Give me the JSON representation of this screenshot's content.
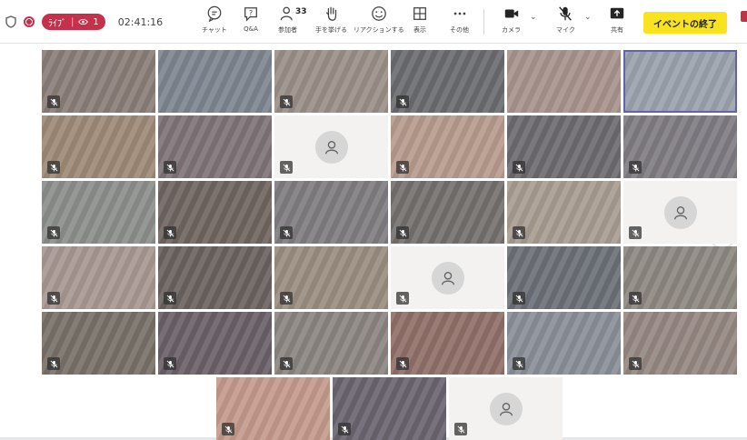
{
  "toolbar": {
    "live_label": "ﾗｲﾌﾞ",
    "viewer_count": "1",
    "elapsed_time": "02:41:16",
    "buttons": [
      {
        "label": "チャット",
        "icon": "chat-icon"
      },
      {
        "label": "Q&A",
        "icon": "qa-icon"
      },
      {
        "label": "参加者",
        "icon": "participants-icon",
        "count": "33"
      },
      {
        "label": "手を挙げる",
        "icon": "raise-hand-icon"
      },
      {
        "label": "リアクションする",
        "icon": "reaction-icon"
      },
      {
        "label": "表示",
        "icon": "view-icon"
      },
      {
        "label": "その他",
        "icon": "more-icon"
      },
      {
        "label": "カメラ",
        "icon": "camera-icon"
      },
      {
        "label": "マイク",
        "icon": "mic-off-icon"
      },
      {
        "label": "共有",
        "icon": "share-icon"
      }
    ],
    "end_event_label": "イベントの終了",
    "accent_color": "#f8e31e",
    "live_color": "#c4314b"
  },
  "grid": {
    "empty_tile_icon": "participant-avatar-icon",
    "muted_icon": "mic-muted-icon",
    "next_page_icon": "chevron-right-icon",
    "tiles": [
      {
        "tone": "#8a7d78",
        "muted": true
      },
      {
        "tone": "#7d8590",
        "muted": false
      },
      {
        "tone": "#9a8f88",
        "muted": true
      },
      {
        "tone": "#6b6c70",
        "muted": true
      },
      {
        "tone": "#a8928c",
        "muted": false
      },
      {
        "tone": "#9ba2ad",
        "muted": false,
        "active": true
      },
      {
        "tone": "#9d8a76",
        "muted": true
      },
      {
        "tone": "#7e7478",
        "muted": true
      },
      {
        "empty": true,
        "muted": true
      },
      {
        "tone": "#b89a8d",
        "muted": true
      },
      {
        "tone": "#6d6a70",
        "muted": true
      },
      {
        "tone": "#7f7b82",
        "muted": true
      },
      {
        "tone": "#8c8e8b",
        "muted": true
      },
      {
        "tone": "#6f6460",
        "muted": true
      },
      {
        "tone": "#807c80",
        "muted": true
      },
      {
        "tone": "#74706e",
        "muted": true
      },
      {
        "tone": "#a79c90",
        "muted": true
      },
      {
        "empty": true,
        "muted": true
      },
      {
        "tone": "#a89792",
        "muted": true
      },
      {
        "tone": "#6a625e",
        "muted": true
      },
      {
        "tone": "#9a8c80",
        "muted": true
      },
      {
        "empty": true,
        "muted": true
      },
      {
        "tone": "#6b6f77",
        "muted": true
      },
      {
        "tone": "#8c8881",
        "muted": true
      },
      {
        "tone": "#787068",
        "muted": true
      },
      {
        "tone": "#6a6068",
        "muted": true
      },
      {
        "tone": "#8b8580",
        "muted": true
      },
      {
        "tone": "#906f68",
        "muted": true
      },
      {
        "tone": "#8a8f98",
        "muted": true
      },
      {
        "tone": "#958782",
        "muted": true
      },
      {
        "tone": "#c49a8c",
        "muted": true
      },
      {
        "tone": "#6a6470",
        "muted": true
      },
      {
        "empty": true,
        "muted": true
      }
    ]
  }
}
